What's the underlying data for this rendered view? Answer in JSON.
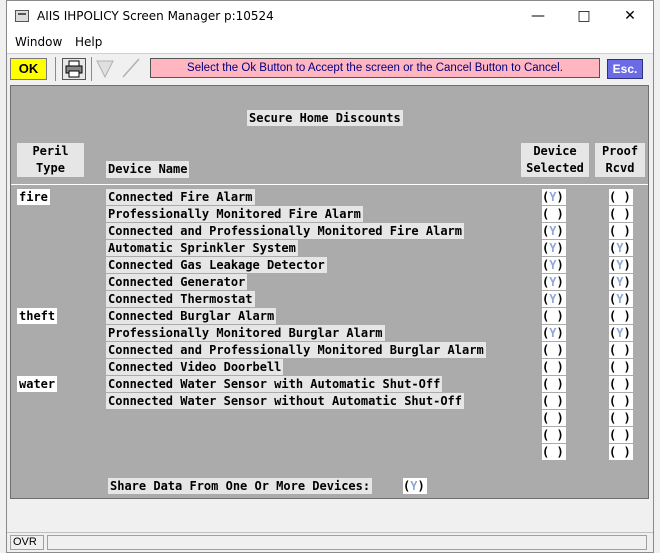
{
  "window": {
    "title": "AIIS IHPOLICY Screen Manager p:10524"
  },
  "menu": {
    "window": "Window",
    "help": "Help"
  },
  "toolbar": {
    "ok_label": "OK",
    "message": "Select the Ok Button to Accept the screen or the Cancel Button to Cancel.",
    "esc_label": "Esc."
  },
  "form": {
    "title": "Secure Home Discounts",
    "col_peril_line1": "Peril",
    "col_peril_line2": "Type",
    "col_device_name": "Device Name",
    "col_selected_line1": "Device",
    "col_selected_line2": "Selected",
    "col_proof_line1": "Proof",
    "col_proof_line2": "Rcvd",
    "perils": {
      "fire": "fire",
      "theft": "theft",
      "water": "water"
    },
    "devices": [
      "Connected Fire Alarm",
      "Professionally Monitored Fire Alarm",
      "Connected and Professionally Monitored Fire Alarm",
      "Automatic Sprinkler System",
      "Connected Gas Leakage Detector",
      "Connected Generator",
      "Connected Thermostat",
      "Connected Burglar Alarm",
      "Professionally Monitored Burglar Alarm",
      "Connected and Professionally Monitored Burglar Alarm",
      "Connected Video Doorbell",
      "Connected Water Sensor with Automatic Shut-Off",
      "Connected Water Sensor without Automatic Shut-Off"
    ],
    "selected": [
      "Y",
      " ",
      "Y",
      "Y",
      "Y",
      "Y",
      "Y",
      " ",
      "Y",
      " ",
      " ",
      " ",
      " ",
      " ",
      " ",
      " "
    ],
    "proof": [
      " ",
      " ",
      " ",
      "Y",
      "Y",
      "Y",
      "Y",
      " ",
      "Y",
      " ",
      " ",
      " ",
      " ",
      " ",
      " ",
      " "
    ],
    "share_label": "Share Data From One Or More Devices:",
    "share_value": "Y"
  },
  "status": {
    "mode": "OVR"
  }
}
